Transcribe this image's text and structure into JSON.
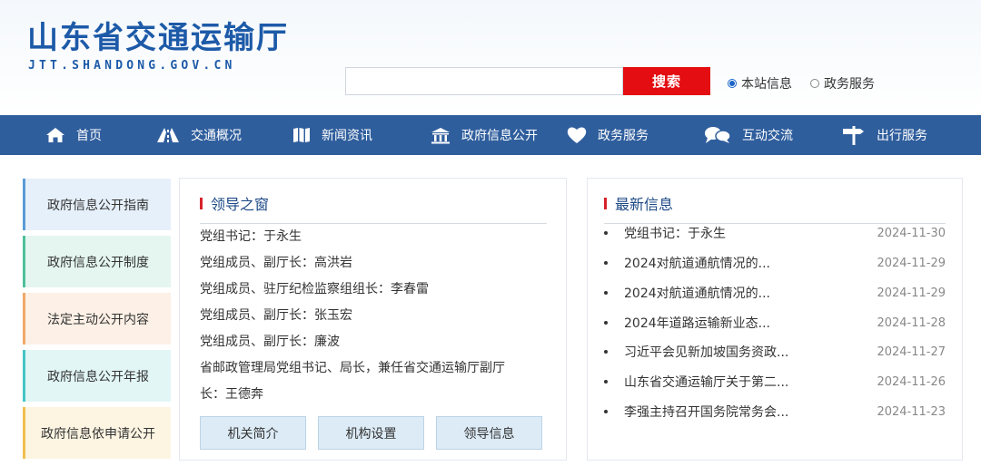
{
  "header": {
    "logo_title": "山东省交通运输厅",
    "logo_sub": "JTT.SHANDONG.GOV.CN",
    "search_value": "",
    "search_button": "搜索",
    "radio_options": [
      {
        "label": "本站信息",
        "checked": true
      },
      {
        "label": "政务服务",
        "checked": false
      }
    ]
  },
  "nav": {
    "items": [
      {
        "label": "首页",
        "icon": "home-icon"
      },
      {
        "label": "交通概况",
        "icon": "road-icon"
      },
      {
        "label": "新闻资讯",
        "icon": "book-icon"
      },
      {
        "label": "政府信息公开",
        "icon": "building-icon"
      },
      {
        "label": "政务服务",
        "icon": "heart-icon"
      },
      {
        "label": "互动交流",
        "icon": "chat-icon"
      },
      {
        "label": "出行服务",
        "icon": "signpost-icon"
      }
    ]
  },
  "sidebar": {
    "items": [
      {
        "label": "政府信息公开指南",
        "bg": "#e6f0fa",
        "border": "#5b9bd5"
      },
      {
        "label": "政府信息公开制度",
        "bg": "#e4f6ef",
        "border": "#4fc09a"
      },
      {
        "label": "法定主动公开内容",
        "bg": "#fdf0e6",
        "border": "#f0a868"
      },
      {
        "label": "政府信息公开年报",
        "bg": "#e2f6f6",
        "border": "#44c4c4"
      },
      {
        "label": "政府信息依申请公开",
        "bg": "#fdf5e2",
        "border": "#f0c050"
      }
    ]
  },
  "leaders": {
    "title": "领导之窗",
    "lines": [
      "党组书记：于永生",
      "党组成员、副厅长：高洪岩",
      "党组成员、驻厅纪检监察组组长：李春雷",
      "党组成员、副厅长：张玉宏",
      "党组成员、副厅长：廉波",
      "省邮政管理局党组书记、局长，兼任省交通运输厅副厅长：王德奔"
    ],
    "buttons": [
      "机关简介",
      "机构设置",
      "领导信息"
    ]
  },
  "news": {
    "title": "最新信息",
    "items": [
      {
        "title": "党组书记：于永生",
        "date": "2024-11-30"
      },
      {
        "title": "2024对航道通航情况的...",
        "date": "2024-11-29"
      },
      {
        "title": "2024对航道通航情况的...",
        "date": "2024-11-29"
      },
      {
        "title": "2024年道路运输新业态...",
        "date": "2024-11-28"
      },
      {
        "title": "习近平会见新加坡国务资政...",
        "date": "2024-11-27"
      },
      {
        "title": "山东省交通运输厅关于第二...",
        "date": "2024-11-26"
      },
      {
        "title": "李强主持召开国务院常务会...",
        "date": "2024-11-23"
      }
    ]
  },
  "colors": {
    "brand_blue": "#1d5aa8",
    "nav_bg": "#2f5e9d",
    "search_red": "#e30d12",
    "title_bar_red": "#d8232a"
  }
}
